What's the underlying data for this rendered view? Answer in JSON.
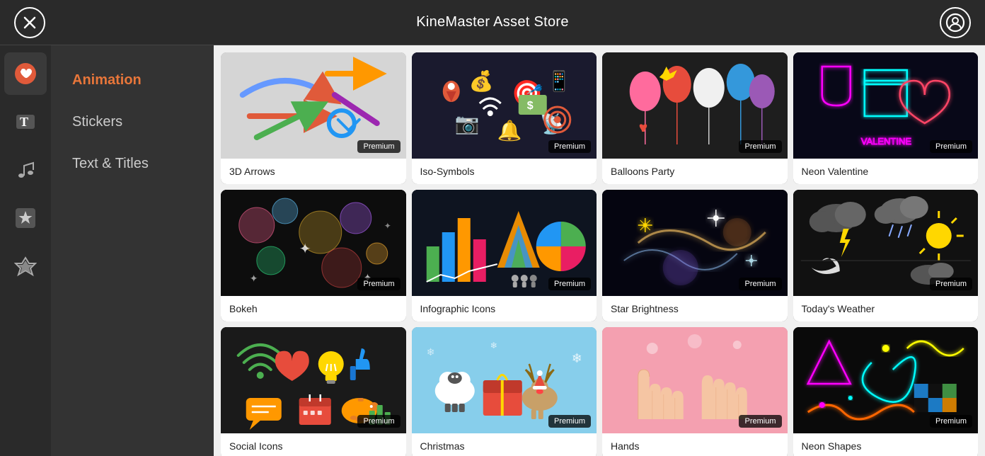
{
  "topbar": {
    "title": "KineMaster Asset Store",
    "close_label": "×",
    "profile_label": "👤"
  },
  "sidebar_icons": [
    {
      "name": "heart-icon",
      "symbol": "♥",
      "active": true
    },
    {
      "name": "text-icon",
      "symbol": "T",
      "active": false
    },
    {
      "name": "music-icon",
      "symbol": "♪",
      "active": false
    },
    {
      "name": "effects-icon",
      "symbol": "★",
      "active": false
    },
    {
      "name": "premium-icon",
      "symbol": "◆",
      "active": false
    }
  ],
  "categories": [
    {
      "name": "Animation",
      "active": true
    },
    {
      "name": "Stickers",
      "active": false
    },
    {
      "name": "Text & Titles",
      "active": false
    }
  ],
  "assets": [
    {
      "id": "3d-arrows",
      "name": "3D Arrows",
      "badge": "Premium",
      "thumb_class": "thumb-3darrows",
      "emoji": "➡️ ↗️ ⬆️ ↩️"
    },
    {
      "id": "iso-symbols",
      "name": "Iso-Symbols",
      "badge": "Premium",
      "thumb_class": "thumb-isosymbols",
      "emoji": "📍 💰 🎯 📱"
    },
    {
      "id": "balloons-party",
      "name": "Balloons Party",
      "badge": "Premium",
      "thumb_class": "thumb-balloons",
      "emoji": "🎈 ❤️ 🎁 🎊"
    },
    {
      "id": "neon-valentine",
      "name": "Neon Valentine",
      "badge": "Premium",
      "thumb_class": "thumb-neon",
      "emoji": "💝 🍸 🎁 💕"
    },
    {
      "id": "bokeh",
      "name": "Bokeh",
      "badge": "Premium",
      "thumb_class": "thumb-bokeh",
      "emoji": "✨ 💫 🌟 ⭐"
    },
    {
      "id": "infographic-icons",
      "name": "Infographic Icons",
      "badge": "Premium",
      "thumb_class": "thumb-infographic",
      "emoji": "📊 📈 🥧 👥"
    },
    {
      "id": "star-brightness",
      "name": "Star Brightness",
      "badge": "Premium",
      "thumb_class": "thumb-starbrightness",
      "emoji": "✨ 🌟 💫 ✨"
    },
    {
      "id": "todays-weather",
      "name": "Today's Weather",
      "badge": "Premium",
      "thumb_class": "thumb-weather",
      "emoji": "☁️ ⛈️ ☀️ 🌙"
    },
    {
      "id": "social-icons",
      "name": "Social Icons",
      "badge": "Premium",
      "thumb_class": "thumb-social",
      "emoji": "📡 ❤️ 💡 👍"
    },
    {
      "id": "xmas-stickers",
      "name": "Christmas",
      "badge": "Premium",
      "thumb_class": "thumb-xmas",
      "emoji": "🐑 🎁 🦌 🎄"
    },
    {
      "id": "hands",
      "name": "Hands",
      "badge": "Premium",
      "thumb_class": "thumb-hands",
      "emoji": "🤚 🙌 👋 🤲"
    },
    {
      "id": "neon-shapes",
      "name": "Neon Shapes",
      "badge": "Premium",
      "thumb_class": "thumb-neonshapes",
      "emoji": "🔺 🌀 🎮 🎲"
    }
  ]
}
